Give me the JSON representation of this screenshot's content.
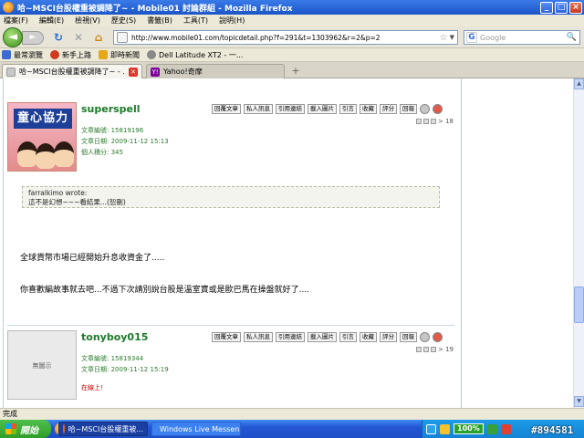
{
  "window": {
    "title": "哈~MSCI台股權重被調降了~ - Mobile01 討論群組 - Mozilla Firefox",
    "minimize": "_",
    "maximize": "□",
    "close": "×"
  },
  "menu": [
    "檔案(F)",
    "編輯(E)",
    "檢視(V)",
    "歷史(S)",
    "書籤(B)",
    "工具(T)",
    "說明(H)"
  ],
  "nav": {
    "url": "http://www.mobile01.com/topicdetail.php?f=291&t=1303962&r=2&p=2",
    "search_placeholder": "Google",
    "search_engine": "G"
  },
  "bookmarks": [
    {
      "label": "最常瀏覽",
      "color": "#3b6bd0"
    },
    {
      "label": "新手上路",
      "color": "#d13a1e"
    },
    {
      "label": "即時新聞",
      "color": "#e3a91a"
    },
    {
      "label": "Dell Latitude XT2 - 一...",
      "color": "#888888"
    }
  ],
  "tabs": [
    {
      "label": "哈~MSCI台股權重被調降了~ - ...",
      "active": true
    },
    {
      "label": "Yahoo!奇摩",
      "active": false
    }
  ],
  "posts": [
    {
      "username": "superspell",
      "avatar_text": "童心協力",
      "actions": [
        "回覆文章",
        "私人訊息",
        "引用連結",
        "載入圖片",
        "引言",
        "收藏",
        "評分",
        "回報"
      ],
      "floor": "> 18",
      "article_id": "文章編號: 15819196",
      "article_date": "文章日期: 2009-11-12 15:13",
      "score": "個人積分: 345",
      "quote_author": "farralkimo wrote:",
      "quote_text": "這不是幻想~~~看結果...(恕刪)",
      "body": [
        "全球貨幣市場已經開始升息收資金了.....",
        "你喜歡編故事就去吧...不過下次請別說台股是溫室寶或是歐巴馬在操盤就好了...."
      ]
    },
    {
      "username": "tonyboy015",
      "avatar_text": "無圖示",
      "actions": [
        "回覆文章",
        "私人訊息",
        "引用連結",
        "載入圖片",
        "引言",
        "收藏",
        "評分",
        "回報"
      ],
      "floor": "> 19",
      "article_id": "文章編號: 15819344",
      "article_date": "文章日期: 2009-11-12 15:19",
      "online": "在線上!"
    }
  ],
  "status": "完成",
  "taskbar": {
    "start": "開始",
    "items": [
      {
        "label": "哈~MSCI台股權重被...",
        "active": true
      },
      {
        "label": "Windows Live Messen...",
        "active": false
      }
    ],
    "battery": "100%",
    "watermark": "#894581"
  }
}
